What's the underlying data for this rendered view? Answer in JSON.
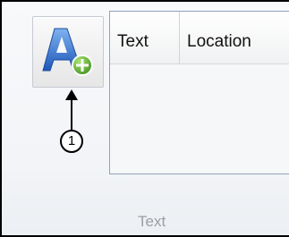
{
  "ribbon_group": {
    "label": "Text",
    "add_button_icon": "add-text-icon"
  },
  "list": {
    "columns": [
      "Text",
      "Location"
    ]
  },
  "callout": {
    "number": "1"
  },
  "colors": {
    "frame_border": "#000000",
    "panel_border": "#8fa3bf",
    "icon_blue": "#2f6fc9",
    "icon_green": "#62b736",
    "group_label": "#9a9fa6"
  }
}
